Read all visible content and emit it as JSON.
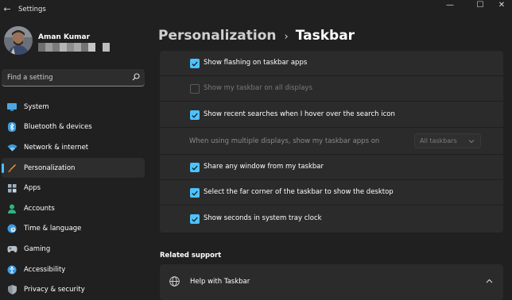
{
  "window": {
    "title": "Settings",
    "back_glyph": "←",
    "minimize_glyph": "—",
    "maximize_glyph": "☐",
    "close_glyph": "✕"
  },
  "profile": {
    "name": "Aman Kumar"
  },
  "search": {
    "placeholder": "Find a setting",
    "icon": "search-icon"
  },
  "sidebar": {
    "items": [
      {
        "label": "System",
        "icon": "system-icon",
        "active": false
      },
      {
        "label": "Bluetooth & devices",
        "icon": "bluetooth-icon",
        "active": false
      },
      {
        "label": "Network & internet",
        "icon": "wifi-icon",
        "active": false
      },
      {
        "label": "Personalization",
        "icon": "brush-icon",
        "active": true
      },
      {
        "label": "Apps",
        "icon": "apps-icon",
        "active": false
      },
      {
        "label": "Accounts",
        "icon": "person-icon",
        "active": false
      },
      {
        "label": "Time & language",
        "icon": "clock-globe-icon",
        "active": false
      },
      {
        "label": "Gaming",
        "icon": "gamepad-icon",
        "active": false
      },
      {
        "label": "Accessibility",
        "icon": "accessibility-icon",
        "active": false
      },
      {
        "label": "Privacy & security",
        "icon": "shield-icon",
        "active": false
      }
    ]
  },
  "breadcrumb": {
    "parent": "Personalization",
    "separator": "›",
    "current": "Taskbar"
  },
  "taskbar_behaviors": {
    "rows": [
      {
        "label": "Show flashing on taskbar apps",
        "checked": true,
        "enabled": true
      },
      {
        "label": "Show my taskbar on all displays",
        "checked": false,
        "enabled": false
      },
      {
        "label": "Show recent searches when I hover over the search icon",
        "checked": true,
        "enabled": true
      },
      {
        "label": "When using multiple displays, show my taskbar apps on",
        "dropdown_value": "All taskbars",
        "enabled": false
      },
      {
        "label": "Share any window from my taskbar",
        "checked": true,
        "enabled": true
      },
      {
        "label": "Select the far corner of the taskbar to show the desktop",
        "checked": true,
        "enabled": true
      },
      {
        "label": "Show seconds in system tray clock",
        "checked": true,
        "enabled": true
      }
    ]
  },
  "related_support": {
    "heading": "Related support",
    "help_label": "Help with Taskbar",
    "help_icon": "globe-icon",
    "expand_icon": "chevron-up-icon"
  },
  "colors": {
    "accent": "#4cc2ff",
    "background": "#202020",
    "card": "#2b2b2b"
  }
}
